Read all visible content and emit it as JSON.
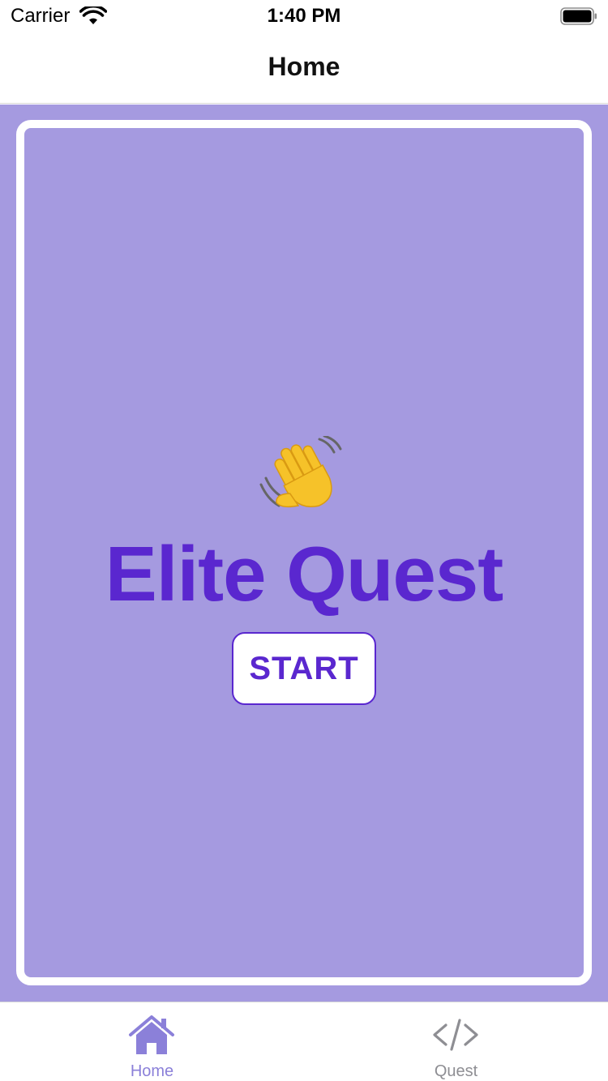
{
  "status_bar": {
    "carrier": "Carrier",
    "time": "1:40 PM",
    "wifi_icon": "wifi-icon",
    "battery_icon": "battery-icon"
  },
  "nav": {
    "title": "Home"
  },
  "main": {
    "emoji": "waving-hand-icon",
    "title": "Elite Quest",
    "start_button_label": "START"
  },
  "tabs": [
    {
      "label": "Home",
      "icon": "house-icon",
      "selected": true
    },
    {
      "label": "Quest",
      "icon": "code-brackets-icon",
      "selected": false
    }
  ],
  "colors": {
    "background": "#a59ae0",
    "accent": "#5a27cf",
    "tab_selected": "#8b80d9",
    "tab_unselected": "#8e8e93"
  }
}
